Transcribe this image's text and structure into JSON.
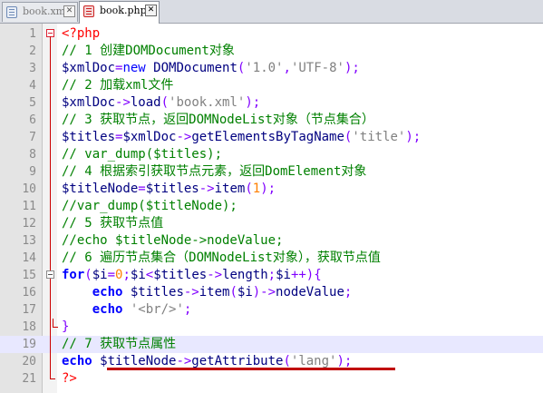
{
  "tabs": [
    {
      "label": "book.xml",
      "active": false
    },
    {
      "label": "book.php",
      "active": true
    }
  ],
  "code_lines": [
    {
      "n": "1",
      "tokens": [
        [
          "php",
          "<?php"
        ]
      ]
    },
    {
      "n": "2",
      "tokens": [
        [
          "cm",
          "// 1 创建DOMDocument对象"
        ]
      ]
    },
    {
      "n": "3",
      "tokens": [
        [
          "var",
          "$xmlDoc"
        ],
        [
          "op",
          "="
        ],
        [
          "kw",
          "new"
        ],
        [
          "fn",
          " DOMDocument"
        ],
        [
          "op",
          "("
        ],
        [
          "str",
          "'1.0'"
        ],
        [
          "op",
          ","
        ],
        [
          "str",
          "'UTF-8'"
        ],
        [
          "op",
          ");"
        ]
      ]
    },
    {
      "n": "4",
      "tokens": [
        [
          "cm",
          "// 2 加载xml文件"
        ]
      ]
    },
    {
      "n": "5",
      "tokens": [
        [
          "var",
          "$xmlDoc"
        ],
        [
          "op",
          "->"
        ],
        [
          "fn",
          "load"
        ],
        [
          "op",
          "("
        ],
        [
          "str",
          "'book.xml'"
        ],
        [
          "op",
          ");"
        ]
      ]
    },
    {
      "n": "6",
      "tokens": [
        [
          "cm",
          "// 3 获取节点，返回DOMNodeList对象（节点集合）"
        ]
      ]
    },
    {
      "n": "7",
      "tokens": [
        [
          "var",
          "$titles"
        ],
        [
          "op",
          "="
        ],
        [
          "var",
          "$xmlDoc"
        ],
        [
          "op",
          "->"
        ],
        [
          "fn",
          "getElementsByTagName"
        ],
        [
          "op",
          "("
        ],
        [
          "str",
          "'title'"
        ],
        [
          "op",
          ");"
        ]
      ]
    },
    {
      "n": "8",
      "tokens": [
        [
          "cm",
          "// var_dump($titles);"
        ]
      ]
    },
    {
      "n": "9",
      "tokens": [
        [
          "cm",
          "// 4 根据索引获取节点元素，返回DomElement对象"
        ]
      ]
    },
    {
      "n": "10",
      "tokens": [
        [
          "var",
          "$titleNode"
        ],
        [
          "op",
          "="
        ],
        [
          "var",
          "$titles"
        ],
        [
          "op",
          "->"
        ],
        [
          "fn",
          "item"
        ],
        [
          "op",
          "("
        ],
        [
          "num",
          "1"
        ],
        [
          "op",
          ");"
        ]
      ]
    },
    {
      "n": "11",
      "tokens": [
        [
          "cm",
          "//var_dump($titleNode);"
        ]
      ]
    },
    {
      "n": "12",
      "tokens": [
        [
          "cm",
          "// 5 获取节点值"
        ]
      ]
    },
    {
      "n": "13",
      "tokens": [
        [
          "cm",
          "//echo $titleNode->nodeValue;"
        ]
      ]
    },
    {
      "n": "14",
      "tokens": [
        [
          "cm",
          "// 6 遍历节点集合（DOMNodeList对象），获取节点值"
        ]
      ]
    },
    {
      "n": "15",
      "tokens": [
        [
          "kwb",
          "for"
        ],
        [
          "op",
          "("
        ],
        [
          "var",
          "$i"
        ],
        [
          "op",
          "="
        ],
        [
          "num",
          "0"
        ],
        [
          "op",
          ";"
        ],
        [
          "var",
          "$i"
        ],
        [
          "op",
          "<"
        ],
        [
          "var",
          "$titles"
        ],
        [
          "op",
          "->"
        ],
        [
          "fn",
          "length"
        ],
        [
          "op",
          ";"
        ],
        [
          "var",
          "$i"
        ],
        [
          "op",
          "++){"
        ]
      ]
    },
    {
      "n": "16",
      "tokens": [
        [
          "plain",
          "    "
        ],
        [
          "kwb",
          "echo"
        ],
        [
          "var",
          " $titles"
        ],
        [
          "op",
          "->"
        ],
        [
          "fn",
          "item"
        ],
        [
          "op",
          "("
        ],
        [
          "var",
          "$i"
        ],
        [
          "op",
          ")->"
        ],
        [
          "fn",
          "nodeValue"
        ],
        [
          "op",
          ";"
        ]
      ]
    },
    {
      "n": "17",
      "tokens": [
        [
          "plain",
          "    "
        ],
        [
          "kwb",
          "echo"
        ],
        [
          "plain",
          " "
        ],
        [
          "str",
          "'<br/>'"
        ],
        [
          "op",
          ";"
        ]
      ]
    },
    {
      "n": "18",
      "tokens": [
        [
          "op",
          "}"
        ]
      ]
    },
    {
      "n": "19",
      "tokens": [
        [
          "cm",
          "// 7 获取节点属性"
        ]
      ]
    },
    {
      "n": "20",
      "tokens": [
        [
          "kwb",
          "echo"
        ],
        [
          "var",
          " $titleNode"
        ],
        [
          "op",
          "->"
        ],
        [
          "fn",
          "getAttribute"
        ],
        [
          "op",
          "("
        ],
        [
          "str",
          "'lang'"
        ],
        [
          "op",
          ");"
        ]
      ]
    },
    {
      "n": "21",
      "tokens": [
        [
          "php",
          "?>"
        ]
      ]
    }
  ],
  "current_line": "19",
  "colors": {
    "comment": "#008000",
    "php_tag": "#ff0000",
    "keyword": "#0000ff",
    "operator": "#8000ff",
    "string": "#808080",
    "number": "#ff8000",
    "variable": "#000080",
    "annotation_underline": "#c00000"
  }
}
